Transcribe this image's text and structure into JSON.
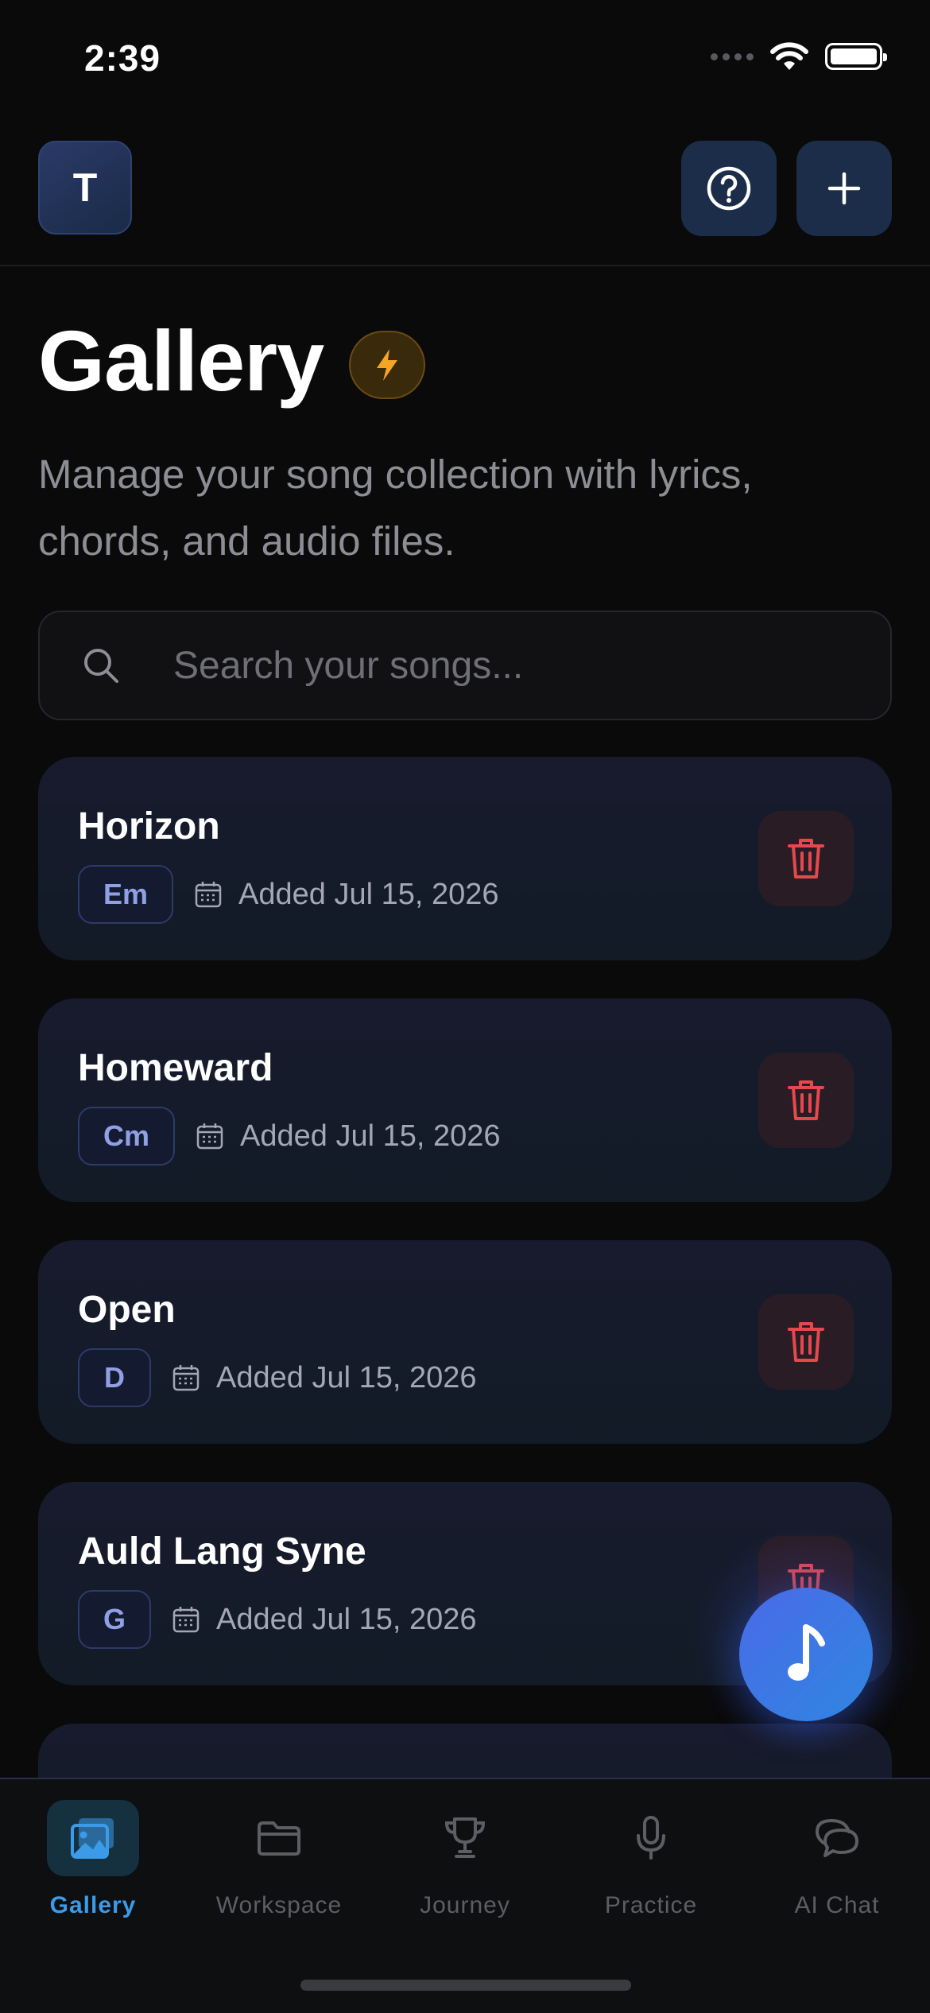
{
  "status_bar": {
    "time": "2:39"
  },
  "header": {
    "avatar_initial": "T"
  },
  "page": {
    "title": "Gallery",
    "subtitle": "Manage your song collection with lyrics, chords, and audio files."
  },
  "search": {
    "placeholder": "Search your songs..."
  },
  "songs": [
    {
      "title": "Horizon",
      "key": "Em",
      "added": "Added Jul 15, 2026"
    },
    {
      "title": "Homeward",
      "key": "Cm",
      "added": "Added Jul 15, 2026"
    },
    {
      "title": "Open",
      "key": "D",
      "added": "Added Jul 15, 2026"
    },
    {
      "title": "Auld Lang Syne",
      "key": "G",
      "added": "Added Jul 15, 2026"
    }
  ],
  "tabs": [
    {
      "label": "Gallery",
      "icon": "gallery-icon",
      "active": true
    },
    {
      "label": "Workspace",
      "icon": "folder-icon",
      "active": false
    },
    {
      "label": "Journey",
      "icon": "trophy-icon",
      "active": false
    },
    {
      "label": "Practice",
      "icon": "microphone-icon",
      "active": false
    },
    {
      "label": "AI Chat",
      "icon": "chat-icon",
      "active": false
    }
  ],
  "colors": {
    "background": "#0a0a0b",
    "accent": "#3b9be8",
    "delete": "#e5484d",
    "badge": "#f5a524"
  }
}
